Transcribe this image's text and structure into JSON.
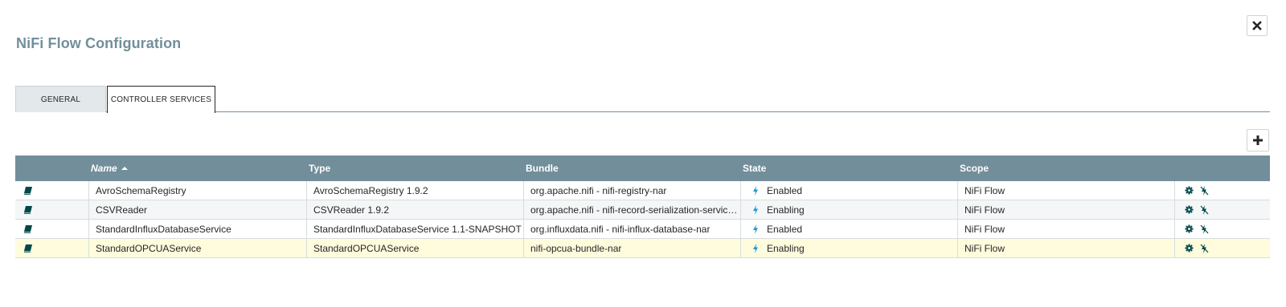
{
  "dialog": {
    "title": "NiFi Flow Configuration",
    "close_icon": "close-icon"
  },
  "tabs": [
    {
      "label": "GENERAL",
      "active": false
    },
    {
      "label": "CONTROLLER SERVICES",
      "active": true
    }
  ],
  "toolbar": {
    "add_icon": "plus-icon"
  },
  "table": {
    "columns": [
      "",
      "Name",
      "Type",
      "Bundle",
      "State",
      "Scope",
      ""
    ],
    "sort": {
      "column": "Name",
      "direction": "ascending"
    },
    "rows": [
      {
        "name": "AvroSchemaRegistry",
        "type": "AvroSchemaRegistry 1.9.2",
        "bundle": "org.apache.nifi - nifi-registry-nar",
        "state": "Enabled",
        "scope": "NiFi Flow"
      },
      {
        "name": "CSVReader",
        "type": "CSVReader 1.9.2",
        "bundle": "org.apache.nifi - nifi-record-serialization-servic…",
        "state": "Enabling",
        "scope": "NiFi Flow"
      },
      {
        "name": "StandardInfluxDatabaseService",
        "type": "StandardInfluxDatabaseService 1.1-SNAPSHOT",
        "bundle": "org.influxdata.nifi - nifi-influx-database-nar",
        "state": "Enabled",
        "scope": "NiFi Flow"
      },
      {
        "name": "StandardOPCUAService",
        "type": "StandardOPCUAService",
        "bundle": "nifi-opcua-bundle-nar",
        "state": "Enabling",
        "scope": "NiFi Flow"
      }
    ]
  },
  "colors": {
    "header_bg": "#728e9b",
    "title": "#728e9b",
    "state_icon": "#1f95d6",
    "selected_row": "#fffbdd"
  }
}
